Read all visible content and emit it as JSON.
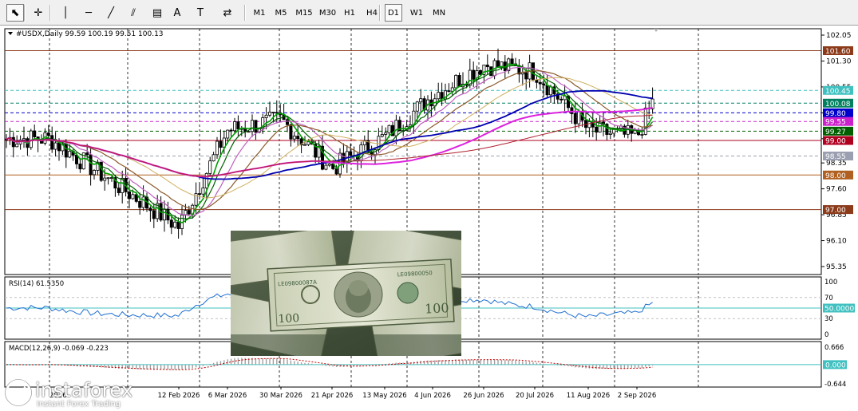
{
  "toolbar": {
    "timeframes": [
      "M1",
      "M5",
      "M15",
      "M30",
      "H1",
      "H4",
      "D1",
      "W1",
      "MN"
    ],
    "active_timeframe": "D1",
    "tools": [
      {
        "name": "cursor-icon",
        "glyph": "⬉"
      },
      {
        "name": "crosshair-icon",
        "glyph": "✛"
      },
      {
        "name": "vertical-line-icon",
        "glyph": "│"
      },
      {
        "name": "horizontal-line-icon",
        "glyph": "─"
      },
      {
        "name": "trendline-icon",
        "glyph": "╱"
      },
      {
        "name": "equidistant-channel-icon",
        "glyph": "⫽"
      },
      {
        "name": "fibonacci-icon",
        "glyph": "▤"
      },
      {
        "name": "text-icon",
        "glyph": "A"
      },
      {
        "name": "text-label-icon",
        "glyph": "T"
      },
      {
        "name": "arrows-icon",
        "glyph": "⇄"
      }
    ]
  },
  "chart": {
    "symbol_header": "#USDX,Daily",
    "ohlc": "99.59 100.19 99.51 100.13",
    "price_axis": [
      "102.05",
      "101.30",
      "100.55",
      "99.80",
      "99.05",
      "98.35",
      "97.60",
      "96.85",
      "96.10",
      "95.35"
    ],
    "price_ticks": [
      102.05,
      101.3,
      100.55,
      99.8,
      99.05,
      98.35,
      97.6,
      96.85,
      96.1,
      95.35
    ],
    "price_range": [
      95.35,
      102.25
    ],
    "price_tags": [
      {
        "label": "101.60",
        "value": 101.6,
        "color": "#8b3a1a"
      },
      {
        "label": "100.45",
        "value": 100.45,
        "color": "#40c0c0"
      },
      {
        "label": "100.08",
        "value": 100.08,
        "color": "#008060"
      },
      {
        "label": "99.80",
        "value": 99.8,
        "color": "#0000cc"
      },
      {
        "label": "99.55",
        "value": 99.55,
        "color": "#cc22cc"
      },
      {
        "label": "99.27",
        "value": 99.27,
        "color": "#006000"
      },
      {
        "label": "99.00",
        "value": 99.0,
        "color": "#b00020"
      },
      {
        "label": "98.55",
        "value": 98.55,
        "color": "#9aa0b0"
      },
      {
        "label": "98.00",
        "value": 98.0,
        "color": "#b06020"
      },
      {
        "label": "97.00",
        "value": 97.0,
        "color": "#8b3a1a"
      }
    ],
    "date_axis": [
      "2026",
      "12 Feb 2026",
      "6 Mar 2026",
      "30 Mar 2026",
      "21 Apr 2026",
      "13 May 2026",
      "4 Jun 2026",
      "26 Jun 2026",
      "20 Jul 2026",
      "11 Aug 2026",
      "2 Sep 2026"
    ]
  },
  "rsi": {
    "label": "RSI(14) 61.5350",
    "axis": [
      "100",
      "70",
      "50",
      "30",
      "0"
    ],
    "level_tag": "50.0000"
  },
  "macd": {
    "label": "MACD(12,26,9) -0.069 -0.223",
    "axis": [
      "0.666",
      "-0.644"
    ],
    "zero_tag": "0.000"
  },
  "watermark": {
    "name": "instaforex",
    "tagline": "Instant Forex Trading"
  },
  "chart_data": {
    "type": "candlestick",
    "symbol": "#USDX",
    "timeframe": "Daily",
    "ohlc_last": {
      "open": 99.59,
      "high": 100.19,
      "low": 99.51,
      "close": 100.13
    },
    "date_labels": [
      "12 Feb 2026",
      "6 Mar 2026",
      "30 Mar 2026",
      "21 Apr 2026",
      "13 May 2026",
      "4 Jun 2026",
      "26 Jun 2026",
      "20 Jul 2026",
      "11 Aug 2026",
      "2 Sep 2026"
    ],
    "approx_close_path": [
      {
        "date": "2026",
        "close": 99.05
      },
      {
        "date": "12 Feb 2026",
        "close": 96.5
      },
      {
        "date": "6 Mar 2026",
        "close": 99.3
      },
      {
        "date": "30 Mar 2026",
        "close": 99.6
      },
      {
        "date": "21 Apr 2026",
        "close": 98.2
      },
      {
        "date": "13 May 2026",
        "close": 99.1
      },
      {
        "date": "4 Jun 2026",
        "close": 100.3
      },
      {
        "date": "26 Jun 2026",
        "close": 101.2
      },
      {
        "date": "20 Jul 2026",
        "close": 101.0
      },
      {
        "date": "11 Aug 2026",
        "close": 99.3
      },
      {
        "date": "2 Sep 2026",
        "close": 99.1
      }
    ],
    "horizontal_levels": [
      101.6,
      100.45,
      100.08,
      99.8,
      99.55,
      99.27,
      99.0,
      98.55,
      98.0,
      97.0
    ],
    "ylim": [
      95.35,
      102.05
    ],
    "rsi_value": 61.535,
    "macd": {
      "main": -0.069,
      "signal": -0.223
    }
  }
}
